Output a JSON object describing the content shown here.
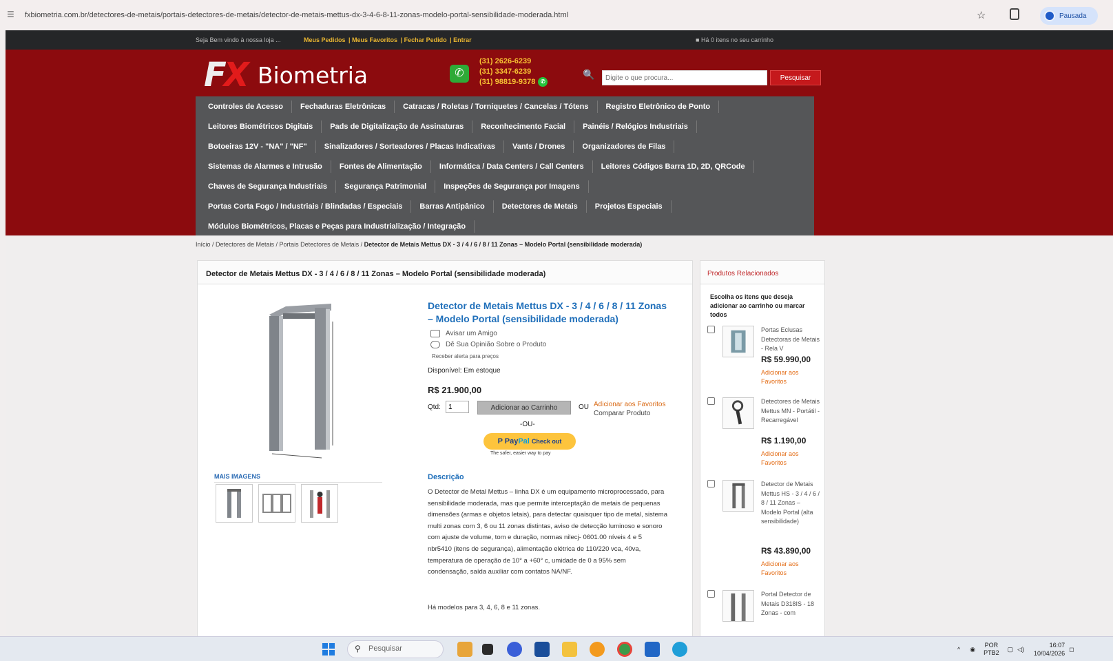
{
  "browser": {
    "url": "fxbiometria.com.br/detectores-de-metais/portais-detectores-de-metais/detector-de-metais-mettus-dx-3-4-6-8-11-zonas-modelo-portal-sensibilidade-moderada.html",
    "profile_label": "Pausada"
  },
  "topbar": {
    "welcome": "Seja Bem vindo à nossa loja ...",
    "links": [
      "Meus Pedidos",
      "Meus Favoritos",
      "Fechar Pedido",
      "Entrar"
    ],
    "cart_info": "Há 0 itens no seu carrinho"
  },
  "header": {
    "logo_mark": "FX",
    "logo_word": "Biometria",
    "phones": [
      "(31) 2626-6239",
      "(31) 3347-6239",
      "(31) 98819-9378"
    ],
    "search_placeholder": "Digite o que procura...",
    "search_button": "Pesquisar"
  },
  "menu": {
    "rows": [
      [
        "Controles de Acesso",
        "Fechaduras Eletrônicas",
        "Catracas / Roletas / Torniquetes / Cancelas / Tótens",
        "Registro Eletrônico de Ponto"
      ],
      [
        "Leitores Biométricos Digitais",
        "Pads de Digitalização de Assinaturas",
        "Reconhecimento Facial",
        "Painéis / Relógios Industriais"
      ],
      [
        "Botoeiras 12V - \"NA\" / \"NF\"",
        "Sinalizadores / Sorteadores / Placas Indicativas",
        "Vants / Drones",
        "Organizadores de Filas"
      ],
      [
        "Sistemas de Alarmes e Intrusão",
        "Fontes de Alimentação",
        "Informática / Data Centers / Call Centers",
        "Leitores Códigos Barra 1D, 2D, QRCode"
      ],
      [
        "Chaves de Segurança Industriais",
        "Segurança Patrimonial",
        "Inspeções de Segurança por Imagens"
      ],
      [
        "Portas Corta Fogo / Industriais / Blindadas / Especiais",
        "Barras Antipânico",
        "Detectores de Metais",
        "Projetos Especiais"
      ],
      [
        "Módulos Biométricos, Placas e Peças para Industrialização / Integração"
      ]
    ]
  },
  "breadcrumb": {
    "path": "Início / Detectores de Metais / Portais Detectores de Metais / ",
    "current": "Detector de Metais Mettus DX - 3 / 4 / 6 / 8 / 11 Zonas – Modelo Portal (sensibilidade moderada)"
  },
  "product": {
    "box_title": "Detector de Metais Mettus DX - 3 / 4 / 6 / 8 / 11 Zonas – Modelo Portal (sensibilidade moderada)",
    "title": "Detector de Metais Mettus DX - 3 / 4 / 6 / 8 / 11 Zonas – Modelo Portal (sensibilidade moderada)",
    "tell_friend": "Avisar um Amigo",
    "review": "Dê Sua Opinião Sobre o Produto",
    "price_alert": "Receber alerta para preços",
    "availability": "Disponível: Em estoque",
    "price": "R$ 21.900,00",
    "qty_label": "Qtd:",
    "qty_value": "1",
    "add_to_cart": "Adicionar ao Carrinho",
    "or": "OU",
    "add_to_favorites": "Adicionar aos Favoritos",
    "compare": "Comparar Produto",
    "or_dash": "-OU-",
    "paypal_pay": "Pay",
    "paypal_pal": "Pal",
    "paypal_checkout": "Check out",
    "paypal_tagline": "The safer, easier way to pay",
    "more_images": "MAIS IMAGENS",
    "description_title": "Descrição",
    "description": "O Detector de Metal Mettus – linha DX é um equipamento microprocessado, para sensibilidade moderada, mas que permite interceptação de metais de pequenas dimensões (armas e objetos letais), para detectar quaisquer tipo de metal, sistema multi zonas com 3, 6 ou 11 zonas distintas, aviso de detecção luminoso e sonoro com ajuste de volume, tom e duração, normas nilecj- 0601.00 níveis 4 e 5 nbr5410 (itens de segurança), alimentação elétrica de 110/220 vca, 40va, temperatura de operação de 10° a +60° c, umidade de 0 a 95% sem condensação, saída auxiliar com contatos NA/NF.",
    "description_more": "Há modelos para 3, 4, 6, 8 e 11 zonas."
  },
  "related": {
    "title": "Produtos Relacionados",
    "intro": "Escolha os itens que deseja adicionar ao carrinho ou marcar todos",
    "items": [
      {
        "name": "Portas Eclusas Detectoras de Metais - Rela V",
        "price": "R$ 59.990,00",
        "fav": "Adicionar aos Favoritos"
      },
      {
        "name": "Detectores de Metais Mettus MN - Portátil - Recarregável",
        "price": "R$ 1.190,00",
        "fav": "Adicionar aos Favoritos"
      },
      {
        "name": "Detector de Metais Mettus HS - 3 / 4 / 6 / 8 / 11 Zonas – Modelo Portal (alta sensibilidade)",
        "price": "R$ 43.890,00",
        "fav": "Adicionar aos Favoritos"
      },
      {
        "name": "Portal Detector de Metais D318IS - 18 Zonas - com",
        "price": "",
        "fav": ""
      }
    ]
  },
  "taskbar": {
    "search_placeholder": "Pesquisar",
    "lang_1": "POR",
    "lang_2": "PTB2",
    "time": "16:07",
    "date": "10/04/2026"
  },
  "colors": {
    "header_red": "#8c0b0e",
    "menu_gray": "#555658",
    "title_blue": "#1f6fba",
    "link_orange": "#e36b14",
    "phone_yellow": "#f7c133"
  }
}
